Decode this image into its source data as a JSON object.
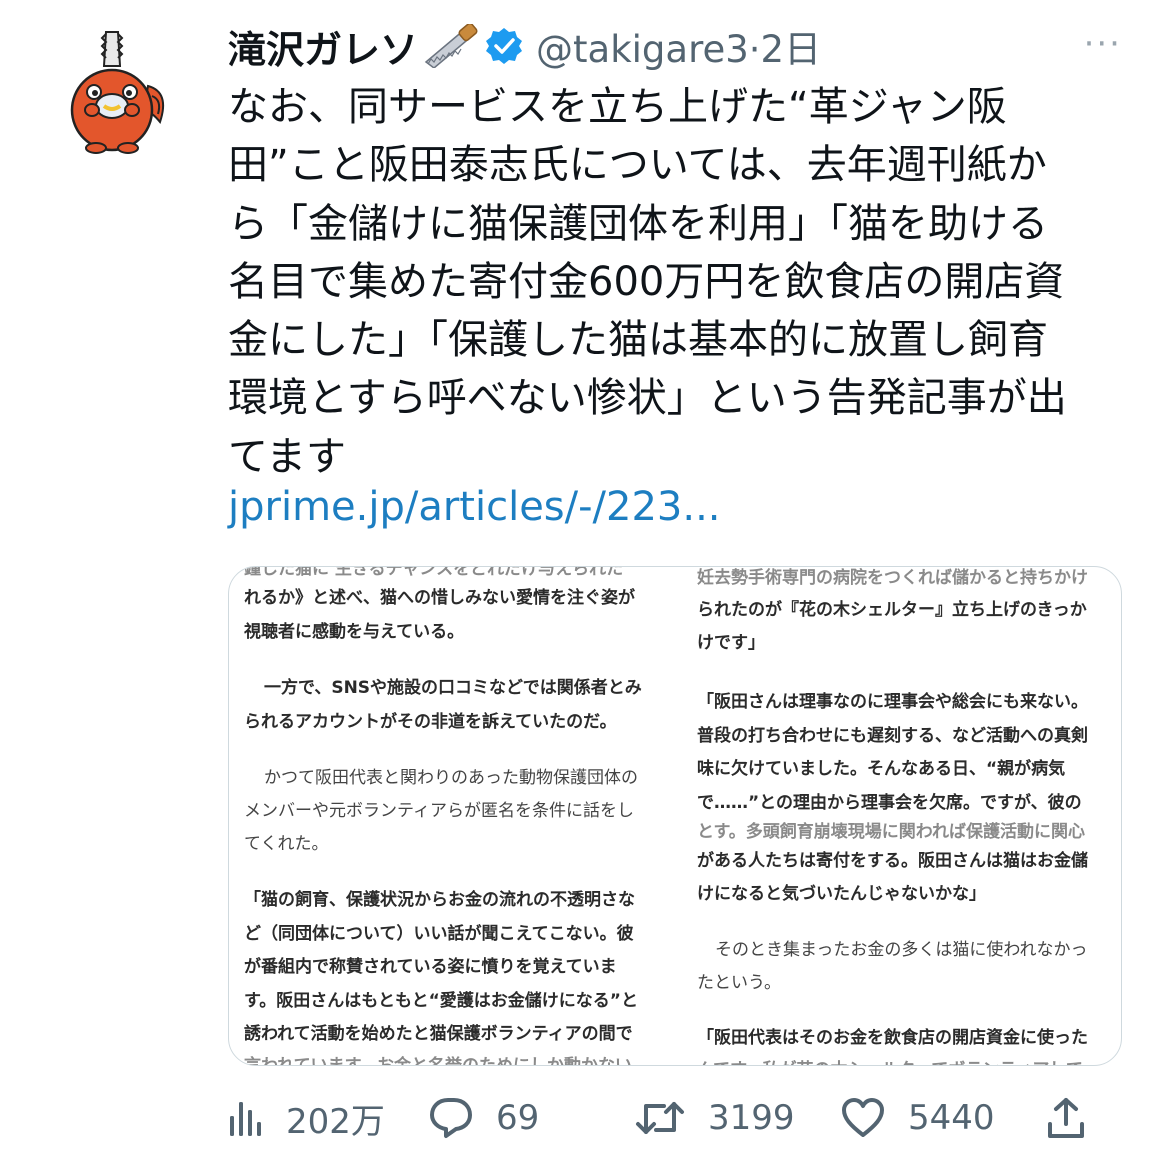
{
  "user": {
    "display_name": "滝沢ガレソ",
    "handle": "@takigare3",
    "separator": "·",
    "time": "2日",
    "more": "···",
    "emoji_icon": "saw-icon",
    "verified_icon": "verified-badge-icon",
    "avatar_icon": "chainsaw-character-avatar"
  },
  "tweet": {
    "lines": [
      "なお、同サービスを立ち上げた“革ジャン阪",
      "田”こと阪田泰志氏については、去年週刊紙か",
      "ら「金儲けに猫保護団体を利用」「猫を助ける",
      "名目で集めた寄付金600万円を飲食店の開店資",
      "金にした」「保護した猫は基本的に放置し飼育",
      "環境とすら呼べない惨状」という告発記事が出",
      "てます"
    ],
    "link": "jprime.jp/articles/-/223..."
  },
  "card": {
    "left_column": [
      "鐘した猫に 生きるチャンスをどれだけ与えられた",
      "れるか》と述べ、猫への惜しみない愛情を注ぐ姿が",
      "視聴者に感動を与えている。",
      "一方で、SNSや施設の口コミなどでは関係者とみ",
      "られるアカウントがその非道を訴えていたのだ。",
      "かつて阪田代表と関わりのあった動物保護団体の",
      "メンバーや元ボランティアらが匿名を条件に話をし",
      "てくれた。",
      "「猫の飼育、保護状況からお金の流れの不透明さな",
      "ど（同団体について）いい話が聞こえてこない。彼",
      "が番組内で称賛されている姿に憤りを覚えていま",
      "す。阪田さんはもともと“愛護はお金儲けになる”と",
      "誘われて活動を始めたと猫保護ボランティアの間で",
      "言われています。お金と名誉のためにしか動かない"
    ],
    "right_column": [
      "妊去勢手術専門の病院をつくれば儲かると持ちかけ",
      "られたのが『花の木シェルター』立ち上げのきっか",
      "けです」",
      "「阪田さんは理事なのに理事会や総会にも来ない。",
      "普段の打ち合わせにも遅刻する、など活動への真剣",
      "味に欠けていました。そんなある日、“親が病気",
      "で……”との理由から理事会を欠席。ですが、彼の",
      "とす。多頭飼育崩壊現場に関われば保護活動に関心",
      "がある人たちは寄付をする。阪田さんは猫はお金儲",
      "けになると気づいたんじゃないかな」",
      "そのとき集まったお金の多くは猫に使われなかっ",
      "たという。",
      "「阪田代表はそのお金を飲食店の開店資金に使った",
      "んです。私が花の木シェルターでボランティアして"
    ]
  },
  "stats": {
    "views": "202万",
    "replies": "69",
    "retweets": "3199",
    "likes": "5440",
    "icons": [
      "views-icon",
      "reply-icon",
      "retweet-icon",
      "like-icon",
      "share-icon"
    ]
  },
  "colors": {
    "text": "#0f1419",
    "secondary": "#536471",
    "link": "#1d7ec1",
    "verified": "#1d9bf0",
    "border": "#cfd9de"
  }
}
